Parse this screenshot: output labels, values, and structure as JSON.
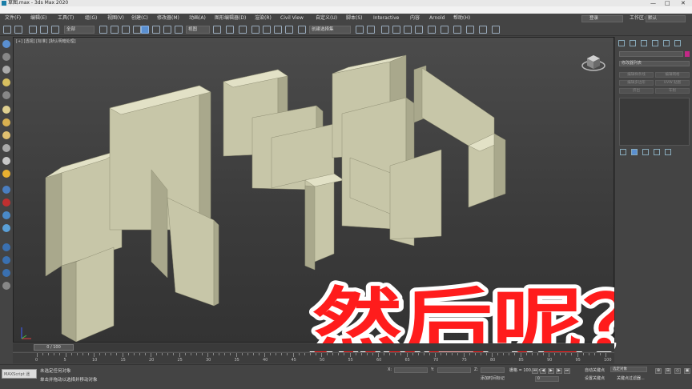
{
  "titlebar": {
    "title": "草图.max - 3ds Max 2020",
    "minimize": "—",
    "maximize": "□",
    "close": "✕"
  },
  "menubar": {
    "items": [
      "文件(F)",
      "编辑(E)",
      "工具(T)",
      "组(G)",
      "视图(V)",
      "创建(C)",
      "修改器(M)",
      "动画(A)",
      "图形编辑器(D)",
      "渲染(R)",
      "Civil View",
      "自定义(U)",
      "脚本(S)",
      "Interactive",
      "内容",
      "Arnold",
      "帮助(H)"
    ],
    "sign_in": "登录",
    "workspace_label": "工作区:",
    "workspace_value": "默认"
  },
  "toolbar": {
    "selection_filter": "全部",
    "ref_coord": "视图",
    "named_selection": "创建选择集"
  },
  "viewport": {
    "label": "[+] [透视] [标准] [默认明暗处理]",
    "axis_x": "x",
    "axis_y": "y",
    "axis_z": "z"
  },
  "caption": {
    "text": "然后呢？",
    "fill": "#ff1c1c",
    "stroke": "#ffffff"
  },
  "command_panel": {
    "modifier_list": "修改器列表",
    "buttons": [
      "编辑样条线",
      "编辑网格",
      "编辑多边形",
      "UVW 贴图",
      "挤出",
      "车削"
    ]
  },
  "timeline": {
    "frame_display": "0 / 100",
    "ticks": [
      "0",
      "5",
      "10",
      "15",
      "20",
      "25",
      "30",
      "35",
      "40",
      "45",
      "50",
      "55",
      "60",
      "65",
      "70",
      "75",
      "80",
      "85",
      "90",
      "95",
      "100"
    ]
  },
  "status": {
    "maxscript": "MAXScript 迷",
    "line1": "未选定任何对象",
    "line2": "单击并拖动以选择并移动对象",
    "x_label": "X:",
    "y_label": "Y:",
    "z_label": "Z:",
    "grid_label": "栅格 = 100.0mm",
    "add_time_tag": "添加时间标记",
    "auto_key": "自动关键点",
    "selected": "选定对象",
    "set_key": "设置关键点",
    "key_filters": "关键点过滤器...",
    "frame": "0"
  },
  "colors": {
    "wall_top": "#e2e1c6",
    "wall_front": "#c7c6a8",
    "wall_side": "#a9a88c",
    "active_icon": "#5a8fd0"
  }
}
